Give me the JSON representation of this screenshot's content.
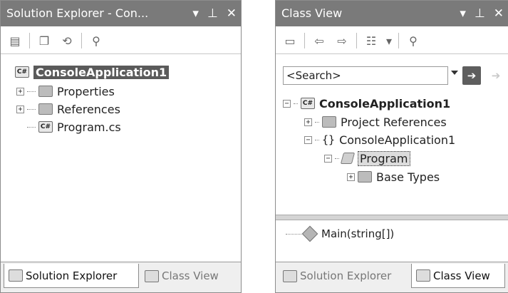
{
  "solution_explorer": {
    "title": "Solution Explorer - Con...",
    "title_controls": [
      "▾",
      "ᵖ",
      "✕"
    ],
    "toolbar_icons": [
      "properties-icon",
      "show-all-files-icon",
      "refresh-icon",
      "view-class-diagram-icon"
    ],
    "tree": {
      "root": "ConsoleApplication1",
      "items": [
        {
          "label": "Properties",
          "expander": "+"
        },
        {
          "label": "References",
          "expander": "+"
        },
        {
          "label": "Program.cs",
          "expander": ""
        }
      ]
    },
    "tabs": {
      "solution_explorer": "Solution Explorer",
      "class_view": "Class View"
    }
  },
  "class_view": {
    "title": "Class View",
    "title_controls": [
      "▾",
      "ᵖ",
      "✕"
    ],
    "search": {
      "placeholder": "<Search>"
    },
    "tree": {
      "root": "ConsoleApplication1",
      "items": [
        {
          "label": "Project References",
          "expander": "+"
        },
        {
          "label": "ConsoleApplication1",
          "expander": "−",
          "icon": "{}"
        },
        {
          "label": "Program",
          "expander": "−"
        },
        {
          "label": "Base Types",
          "expander": "+"
        }
      ]
    },
    "members": [
      {
        "label": "Main(string[])"
      }
    ],
    "tabs": {
      "solution_explorer": "Solution Explorer",
      "class_view": "Class View"
    }
  }
}
